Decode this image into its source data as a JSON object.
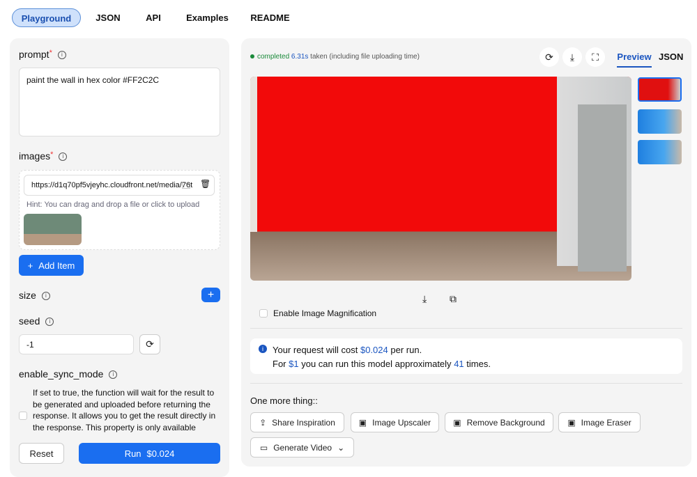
{
  "tabs": [
    "Playground",
    "JSON",
    "API",
    "Examples",
    "README"
  ],
  "left": {
    "prompt_label": "prompt",
    "prompt_value": "paint the wall in hex color #FF2C2C",
    "images_label": "images",
    "image_url": "https://d1q70pf5vjeyhc.cloudfront.net/media/76t",
    "hint": "Hint: You can drag and drop a file or click to upload",
    "add_item": "Add Item",
    "size_label": "size",
    "seed_label": "seed",
    "seed_value": "-1",
    "sync_label": "enable_sync_mode",
    "sync_desc": "If set to true, the function will wait for the result to be generated and uploaded before returning the response. It allows you to get the result directly in the response. This property is only available",
    "reset": "Reset",
    "run": "Run",
    "run_price": "$0.024"
  },
  "right": {
    "status": "completed",
    "time": "6.31s",
    "time_suffix": "taken (including file uploading time)",
    "view_tabs": [
      "Preview",
      "JSON"
    ],
    "magnify": "Enable Image Magnification",
    "cost_a": "Your request will cost",
    "cost_price": "$0.024",
    "cost_b": "per run.",
    "for": "For",
    "dollar": "$1",
    "approx": "you can run this model approximately",
    "runs": "41",
    "times": "times.",
    "more": "One more thing::",
    "actions": [
      "Share Inspiration",
      "Image Upscaler",
      "Remove Background",
      "Image Eraser",
      "Generate Video"
    ]
  }
}
